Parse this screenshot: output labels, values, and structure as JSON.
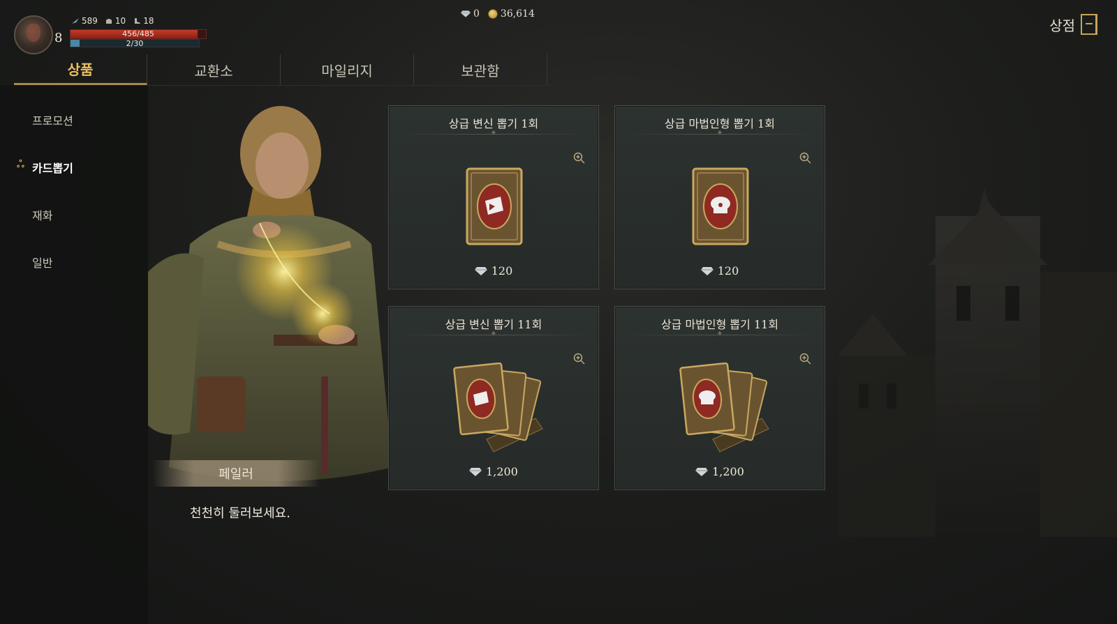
{
  "hud": {
    "level": "8",
    "stats": [
      {
        "icon": "feather-icon",
        "value": "589"
      },
      {
        "icon": "helmet-icon",
        "value": "10"
      },
      {
        "icon": "boot-icon",
        "value": "18"
      }
    ],
    "hp_text": "456/485",
    "hp_fraction": 0.94,
    "mp_text": "2/30",
    "mp_fraction": 0.07
  },
  "currency": {
    "gems": "0",
    "gold": "36,614"
  },
  "header": {
    "title": "상점",
    "exit_icon": "exit-door-icon"
  },
  "tabs": [
    {
      "label": "상품",
      "active": true
    },
    {
      "label": "교환소",
      "active": false
    },
    {
      "label": "마일리지",
      "active": false
    },
    {
      "label": "보관함",
      "active": false
    }
  ],
  "sidebar": {
    "items": [
      {
        "label": "프로모션",
        "active": false
      },
      {
        "label": "카드뽑기",
        "active": true
      },
      {
        "label": "재화",
        "active": false
      },
      {
        "label": "일반",
        "active": false
      }
    ]
  },
  "npc": {
    "name": "페일러",
    "dialog": "천천히 둘러보세요."
  },
  "cards": [
    {
      "title": "상급 변신 뽑기 1회",
      "price": "120",
      "emblem": "transform-emblem-icon",
      "count": "single"
    },
    {
      "title": "상급 마법인형 뽑기 1회",
      "price": "120",
      "emblem": "doll-emblem-icon",
      "count": "single"
    },
    {
      "title": "상급 변신 뽑기 11회",
      "price": "1,200",
      "emblem": "transform-emblem-icon",
      "count": "stack"
    },
    {
      "title": "상급 마법인형 뽑기 11회",
      "price": "1,200",
      "emblem": "doll-emblem-icon",
      "count": "stack"
    }
  ],
  "colors": {
    "accent_gold": "#e8c060",
    "hp_red": "#c23a2a",
    "mp_blue": "#4a86a6",
    "card_red": "#8e2a22"
  }
}
